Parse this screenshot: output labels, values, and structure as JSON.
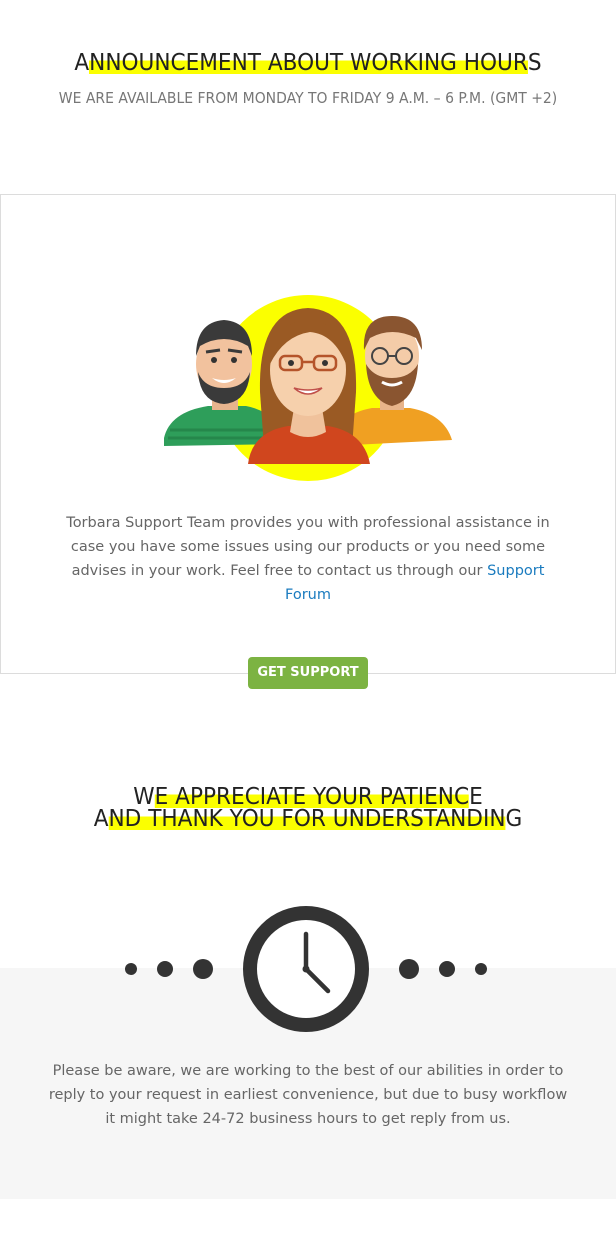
{
  "announcement": {
    "title_first": "A",
    "title_middle": "NNOUNCEMENT ABOUT WORKING HOUR",
    "title_last": "S",
    "subtitle": "WE ARE AVAILABLE FROM MONDAY TO FRIDAY 9 A.M. – 6 P.M. (GMT +2)"
  },
  "support": {
    "text": "Torbara Support Team provides you with professional assistance in case you have some issues using our products or you need some advises in your work. Feel free to contact us through our ",
    "link_label": "Support Forum",
    "button_label": "GET SUPPORT",
    "illustration_icon": "support-team-illustration"
  },
  "thanks": {
    "line1_first": "W",
    "line1_middle": "E APPRECIATE YOUR PATIENC",
    "line1_last": "E",
    "line2_first": "A",
    "line2_middle": "ND THANK YOU FOR UNDERSTANDIN",
    "line2_last": "G"
  },
  "waiting": {
    "icon": "clock-icon",
    "text": "Please be aware, we are working to the best of our abilities in order to reply to your request in earliest convenience, but due to busy workflow it might take 24-72 business hours to get reply from us."
  },
  "colors": {
    "highlight": "#fbff00",
    "button": "#7cb342",
    "link": "#1a7bbf",
    "panel": "#f6f6f6",
    "clock": "#333333"
  }
}
